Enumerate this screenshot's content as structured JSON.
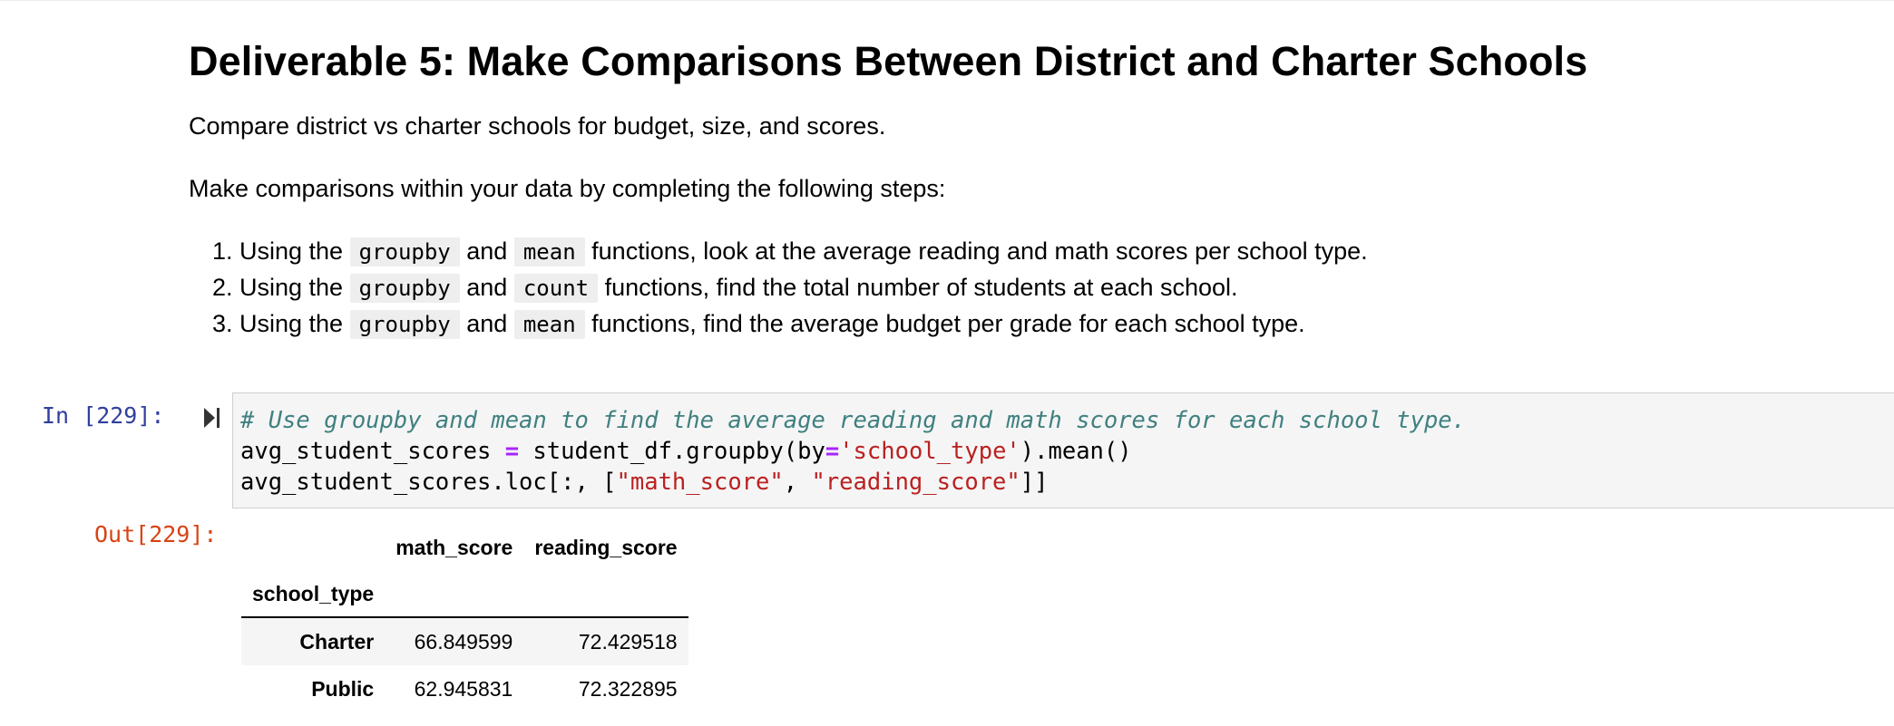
{
  "markdown": {
    "heading": "Deliverable 5: Make Comparisons Between District and Charter Schools",
    "intro": "Compare district vs charter schools for budget, size, and scores.",
    "instructions": "Make comparisons within your data by completing the following steps:",
    "steps": [
      {
        "prefix": "Using the",
        "code1": "groupby",
        "mid": "and",
        "code2": "mean",
        "suffix": "functions, look at the average reading and math scores per school type."
      },
      {
        "prefix": "Using the",
        "code1": "groupby",
        "mid": "and",
        "code2": "count",
        "suffix": "functions, find the total number of students at each school."
      },
      {
        "prefix": "Using the",
        "code1": "groupby",
        "mid": "and",
        "code2": "mean",
        "suffix": "functions, find the average budget per grade for each school type."
      }
    ]
  },
  "code_cell": {
    "in_prompt": "In [229]:",
    "comment": "# Use groupby and mean to find the average reading and math scores for each school type.",
    "line2": {
      "var": "avg_student_scores ",
      "op": "=",
      "call": " student_df.groupby(by",
      "op2": "=",
      "str": "'school_type'",
      "rest": ").mean()"
    },
    "line3": {
      "pre": "avg_student_scores.loc[:, [",
      "s1": "\"math_score\"",
      "sep": ", ",
      "s2": "\"reading_score\"",
      "post": "]]"
    }
  },
  "output": {
    "out_prompt": "Out[229]:",
    "columns": [
      "math_score",
      "reading_score"
    ],
    "index_name": "school_type",
    "rows": [
      {
        "label": "Charter",
        "values": [
          "66.849599",
          "72.429518"
        ]
      },
      {
        "label": "Public",
        "values": [
          "62.945831",
          "72.322895"
        ]
      }
    ]
  }
}
